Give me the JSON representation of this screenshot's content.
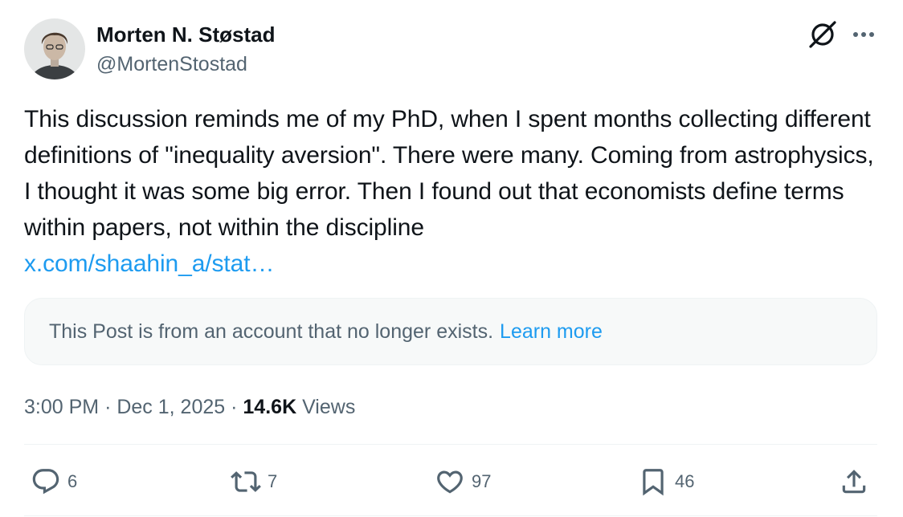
{
  "author": {
    "name": "Morten N. Støstad",
    "handle": "@MortenStostad",
    "avatar_icon": "avatar-photo"
  },
  "post": {
    "text": "This discussion reminds me of my PhD, when I spent months collecting different definitions of \"inequality aversion\". There were many. Coming from astrophysics, I thought it was some big error. Then I found out that economists define terms within papers, not within the discipline",
    "link_text": "x.com/shaahin_a/stat…"
  },
  "notice": {
    "text": "This Post is from an account that no longer exists.",
    "link_text": "Learn more"
  },
  "meta": {
    "time": "3:00 PM",
    "separator": "·",
    "date": "Dec 1, 2025",
    "views_count": "14.6K",
    "views_label": "Views"
  },
  "actions": {
    "replies": "6",
    "reposts": "7",
    "likes": "97",
    "bookmarks": "46"
  },
  "icons": {
    "grok": "grok-icon",
    "more": "more-icon",
    "reply": "reply-icon",
    "repost": "repost-icon",
    "like": "heart-icon",
    "bookmark": "bookmark-icon",
    "share": "share-icon"
  },
  "colors": {
    "link": "#1d9bf0",
    "text": "#0f1419",
    "secondary": "#536471",
    "notice_bg": "#f7f9f9",
    "divider": "#eff3f4"
  }
}
